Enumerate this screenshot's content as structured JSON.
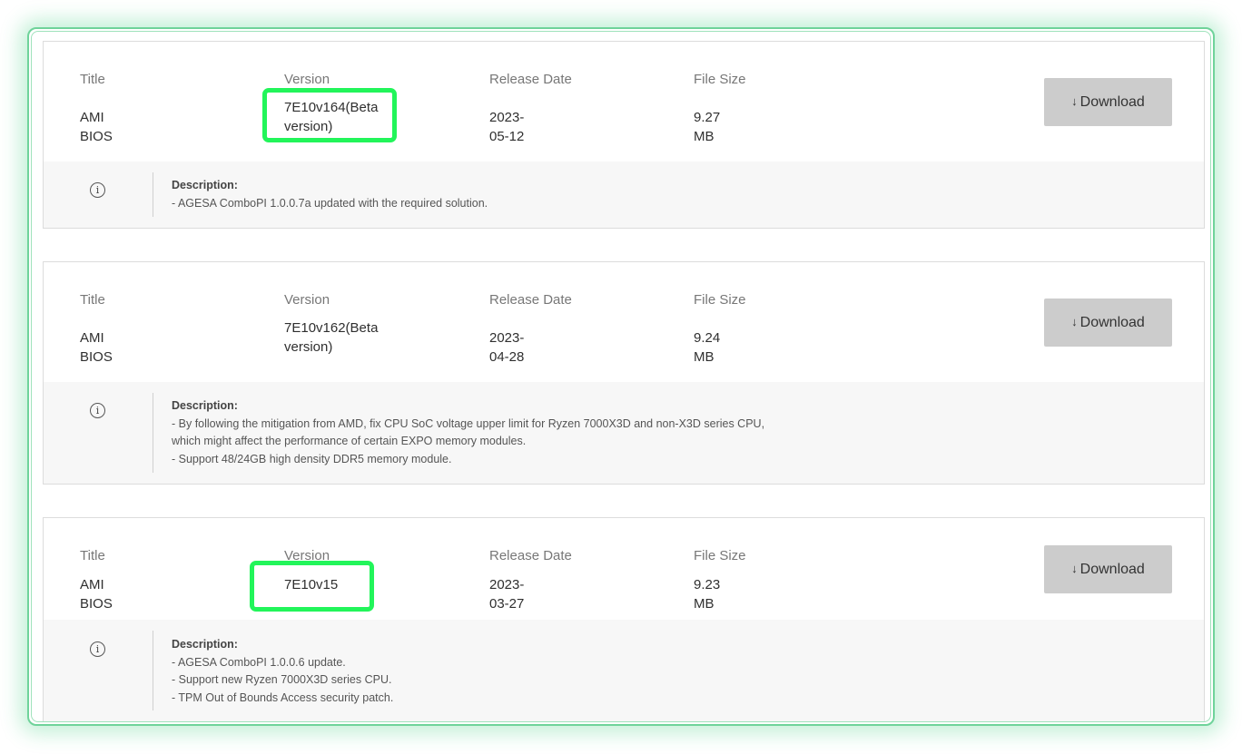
{
  "labels": {
    "title": "Title",
    "version": "Version",
    "release_date": "Release Date",
    "file_size": "File Size",
    "download": "Download",
    "description": "Description:"
  },
  "icons": {
    "download": "arrow-down-icon",
    "info": "info-circle-icon"
  },
  "colors": {
    "highlight": "#22f55a",
    "frame_glow": "#6fd39a",
    "button_bg": "#cccccc",
    "description_bg": "#f7f7f7"
  },
  "downloads": [
    {
      "title": "AMI BIOS",
      "version": "7E10v164(Beta version)",
      "release_date": "2023-05-12",
      "file_size": "9.27 MB",
      "description": [
        "- AGESA ComboPI 1.0.0.7a updated with the required solution."
      ]
    },
    {
      "title": "AMI BIOS",
      "version": "7E10v162(Beta version)",
      "release_date": "2023-04-28",
      "file_size": "9.24 MB",
      "description": [
        "- By following the mitigation from AMD, fix CPU SoC voltage upper limit for Ryzen 7000X3D and non-X3D series CPU,",
        "which might affect the performance of certain EXPO memory modules.",
        "- Support 48/24GB high density DDR5 memory module."
      ]
    },
    {
      "title": "AMI BIOS",
      "version": "7E10v15",
      "release_date": "2023-03-27",
      "file_size": "9.23 MB",
      "description": [
        "- AGESA ComboPI 1.0.0.6 update.",
        "- Support new Ryzen 7000X3D series CPU.",
        "- TPM Out of Bounds Access security patch."
      ]
    }
  ]
}
